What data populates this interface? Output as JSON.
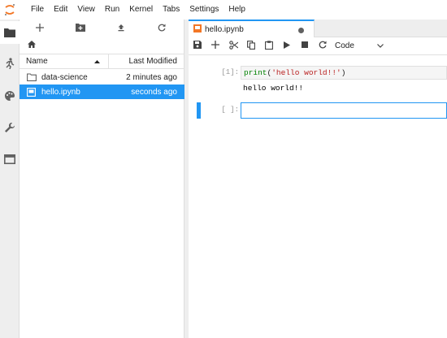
{
  "menu": {
    "items": [
      "File",
      "Edit",
      "View",
      "Run",
      "Kernel",
      "Tabs",
      "Settings",
      "Help"
    ]
  },
  "activity_bar": {
    "icons": [
      "folder-icon",
      "running-icon",
      "palette-icon",
      "wrench-icon",
      "tabs-icon"
    ]
  },
  "file_browser": {
    "toolbar_icons": [
      "plus-icon",
      "new-folder-icon",
      "upload-icon",
      "refresh-icon"
    ],
    "breadcrumb_icon": "home-icon",
    "columns": {
      "name": "Name",
      "modified": "Last Modified"
    },
    "files": [
      {
        "name": "data-science",
        "modified": "2 minutes ago",
        "type": "folder"
      },
      {
        "name": "hello.ipynb",
        "modified": "seconds ago",
        "type": "notebook",
        "selected": true
      }
    ]
  },
  "tab": {
    "label": "hello.ipynb"
  },
  "notebook_toolbar": {
    "cell_type": "Code"
  },
  "cells": [
    {
      "prompt": "[1]:",
      "code_fn": "print",
      "code_open": "(",
      "code_str": "'hello world!!'",
      "code_close": ")",
      "output": "hello world!!"
    },
    {
      "prompt": "[ ]:"
    }
  ],
  "colors": {
    "accent": "#2196f3",
    "selected_row": "#2196f3"
  }
}
